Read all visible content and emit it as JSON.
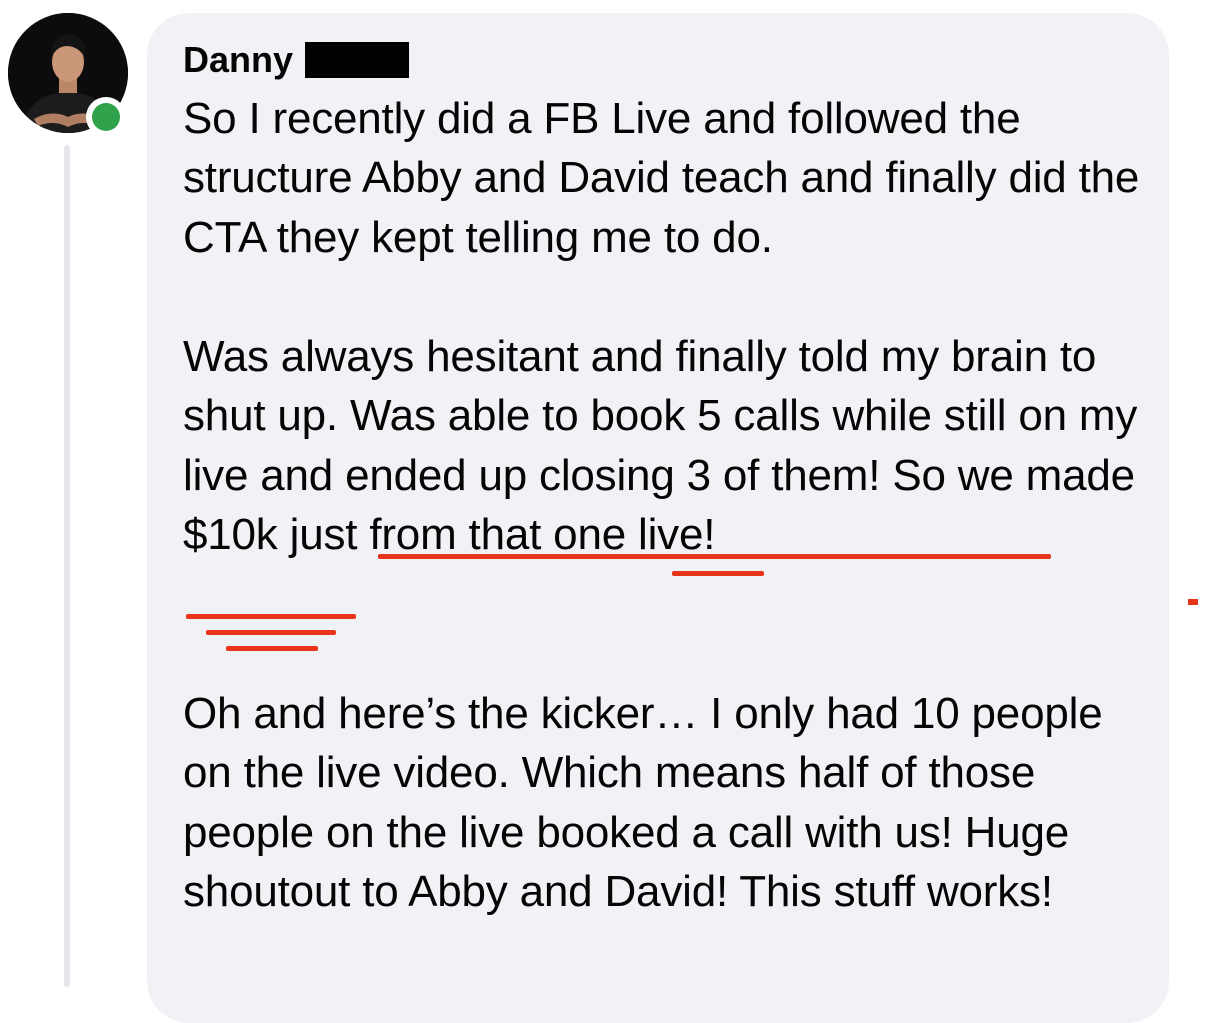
{
  "comment": {
    "author": "Danny",
    "author_surname_redacted": true,
    "online": true,
    "paragraph1": "So I recently did a FB Live and followed the structure Abby and David teach and finally did the CTA they kept telling me to do.",
    "paragraph2_plain": "Was always hesitant and finally told my brain to shut up. Was able to book 5 calls while still on my live and ended up closing 3 of them! ",
    "paragraph2_highlight": "So we made $10k just from that one live!",
    "paragraph3": "Oh and here’s the kicker… I only had 10 people on the live video. Which means half of those people on the live booked a call with us! Huge shoutout to Abby and David! This stuff works!"
  },
  "colors": {
    "bubble": "#f0f2f5",
    "text": "#050505",
    "online_dot": "#31a24c",
    "annotation": "#e8341a",
    "thread_line": "#e4e6eb"
  },
  "icons": {
    "avatar": "profile-photo",
    "presence": "online-status-dot"
  }
}
